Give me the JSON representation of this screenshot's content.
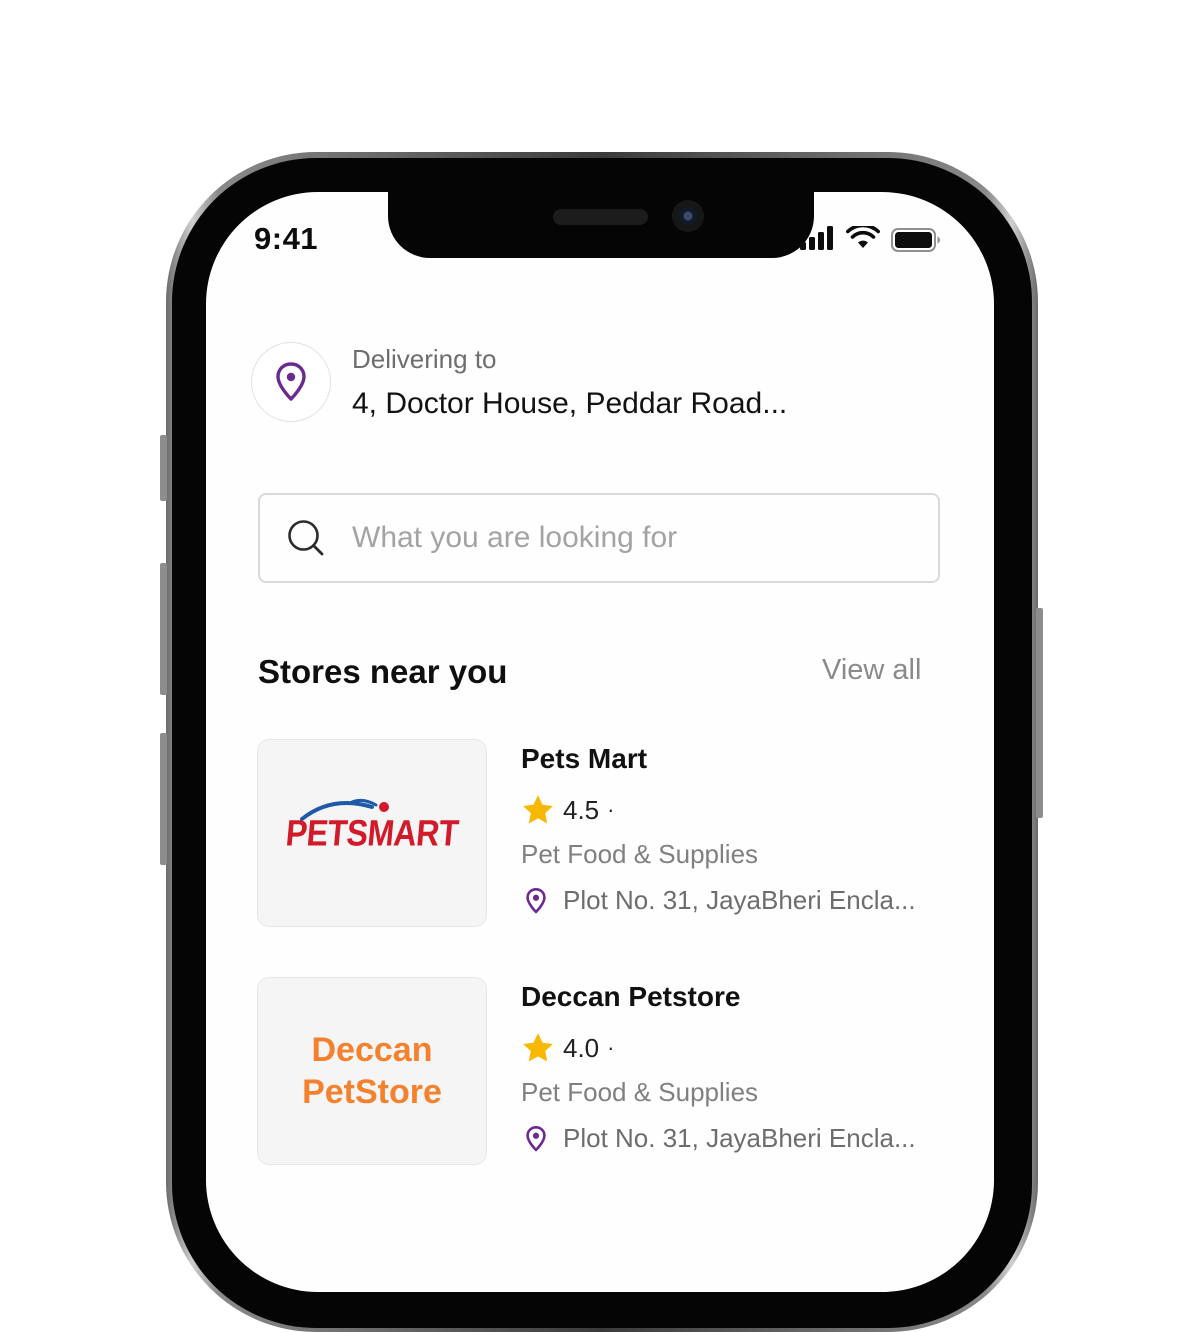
{
  "status_bar": {
    "time": "9:41",
    "icons": [
      "cellular-signal-icon",
      "wifi-icon",
      "battery-icon"
    ]
  },
  "location": {
    "icon": "location-pin-icon",
    "label": "Delivering to",
    "address": "4, Doctor House, Peddar Road..."
  },
  "search": {
    "icon": "search-icon",
    "placeholder": "What you are looking for",
    "value": ""
  },
  "stores_section": {
    "title": "Stores near you",
    "view_all_label": "View all"
  },
  "stores": [
    {
      "name": "Pets Mart",
      "logo_text": "PETSMART",
      "rating": "4.5",
      "separator": "·",
      "category": "Pet Food & Supplies",
      "address": "Plot No. 31, JayaBheri Encla..."
    },
    {
      "name": "Deccan Petstore",
      "logo_text_line1": "Deccan",
      "logo_text_line2": "PetStore",
      "rating": "4.0",
      "separator": "·",
      "category": "Pet Food & Supplies",
      "address": "Plot No. 31, JayaBheri Encla..."
    }
  ],
  "colors": {
    "accent_purple": "#6a2a8f",
    "star_yellow": "#f8b800",
    "petsmart_red": "#d11a2a",
    "deccan_orange": "#f3812d",
    "text_primary": "#111111",
    "text_secondary": "#808080"
  }
}
